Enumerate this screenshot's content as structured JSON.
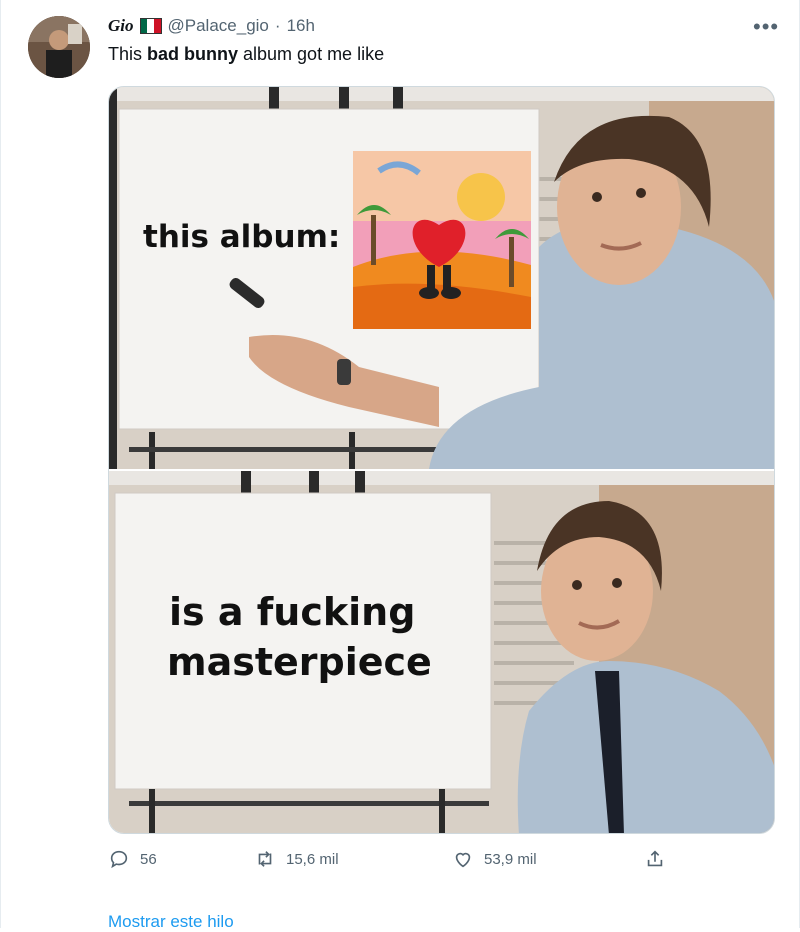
{
  "tweet": {
    "display_name": "Gio",
    "handle": "@Palace_gio",
    "separator": "·",
    "time": "16h",
    "text_before": "This ",
    "text_bold": "bad bunny",
    "text_after": " album got me like",
    "more_icon": "more-dots-icon"
  },
  "meme": {
    "top_text": "this album:",
    "bottom_line1": "is a fucking",
    "bottom_line2": "masterpiece"
  },
  "actions": {
    "replies": "56",
    "retweets": "15,6 mil",
    "likes": "53,9 mil"
  },
  "thread_link": "Mostrar este hilo",
  "colors": {
    "link": "#1d9bf0",
    "muted": "#536471",
    "text": "#0f1419"
  }
}
